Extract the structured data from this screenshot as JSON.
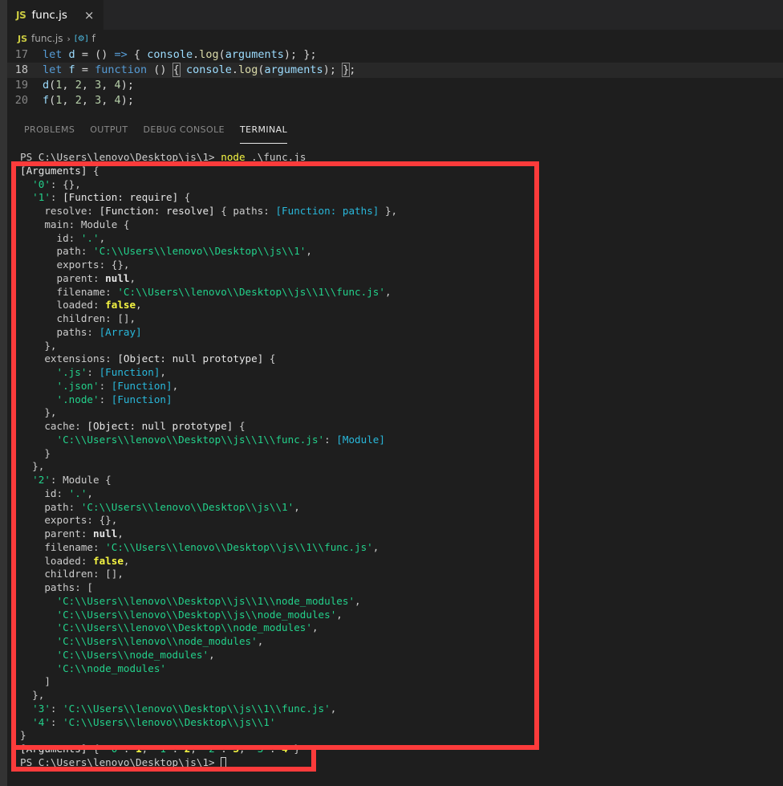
{
  "window": {
    "tab": {
      "label": "func.js",
      "icon": "js-file-icon",
      "close_icon": "×"
    },
    "breadcrumb": {
      "file": "func.js",
      "separator": "›",
      "symbol_icon": "[⚙]",
      "symbol": "f"
    }
  },
  "editor": {
    "lines": [
      {
        "number": "17",
        "text": "let d = () => { console.log(arguments); };",
        "active": false
      },
      {
        "number": "18",
        "text": "let f = function () { console.log(arguments); };",
        "active": true
      },
      {
        "number": "19",
        "text": "d(1, 2, 3, 4);",
        "active": false
      },
      {
        "number": "20",
        "text": "f(1, 2, 3, 4);",
        "active": false
      }
    ]
  },
  "panel": {
    "tabs": [
      {
        "label": "PROBLEMS",
        "active": false
      },
      {
        "label": "OUTPUT",
        "active": false
      },
      {
        "label": "DEBUG CONSOLE",
        "active": false
      },
      {
        "label": "TERMINAL",
        "active": true
      }
    ]
  },
  "terminal": {
    "prompt": "PS C:\\Users\\lenovo\\Desktop\\js\\1>",
    "command": "node .\\func.js",
    "final_prompt": "PS C:\\Users\\lenovo\\Desktop\\js\\1>",
    "lines": [
      "[Arguments] {",
      "  '0': {},",
      "  '1': [Function: require] {",
      "    resolve: [Function: resolve] { paths: [Function: paths] },",
      "    main: Module {",
      "      id: '.',",
      "      path: 'C:\\\\Users\\\\lenovo\\\\Desktop\\\\js\\\\1',",
      "      exports: {},",
      "      parent: null,",
      "      filename: 'C:\\\\Users\\\\lenovo\\\\Desktop\\\\js\\\\1\\\\func.js',",
      "      loaded: false,",
      "      children: [],",
      "      paths: [Array]",
      "    },",
      "    extensions: [Object: null prototype] {",
      "      '.js': [Function],",
      "      '.json': [Function],",
      "      '.node': [Function]",
      "    },",
      "    cache: [Object: null prototype] {",
      "      'C:\\\\Users\\\\lenovo\\\\Desktop\\\\js\\\\1\\\\func.js': [Module]",
      "    }",
      "  },",
      "  '2': Module {",
      "    id: '.',",
      "    path: 'C:\\\\Users\\\\lenovo\\\\Desktop\\\\js\\\\1',",
      "    exports: {},",
      "    parent: null,",
      "    filename: 'C:\\\\Users\\\\lenovo\\\\Desktop\\\\js\\\\1\\\\func.js',",
      "    loaded: false,",
      "    children: [],",
      "    paths: [",
      "      'C:\\\\Users\\\\lenovo\\\\Desktop\\\\js\\\\1\\\\node_modules',",
      "      'C:\\\\Users\\\\lenovo\\\\Desktop\\\\js\\\\node_modules',",
      "      'C:\\\\Users\\\\lenovo\\\\Desktop\\\\node_modules',",
      "      'C:\\\\Users\\\\lenovo\\\\node_modules',",
      "      'C:\\\\Users\\\\node_modules',",
      "      'C:\\\\node_modules'",
      "    ]",
      "  },",
      "  '3': 'C:\\\\Users\\\\lenovo\\\\Desktop\\\\js\\\\1\\\\func.js',",
      "  '4': 'C:\\\\Users\\\\lenovo\\\\Desktop\\\\js\\\\1'",
      "}",
      "[Arguments] { '0': 1, '1': 2, '2': 3, '3': 4 }"
    ]
  },
  "annotations": {
    "box_color": "#fc3b3b",
    "boxes": [
      {
        "name": "arguments-object-highlight"
      },
      {
        "name": "arguments-values-highlight"
      }
    ]
  }
}
